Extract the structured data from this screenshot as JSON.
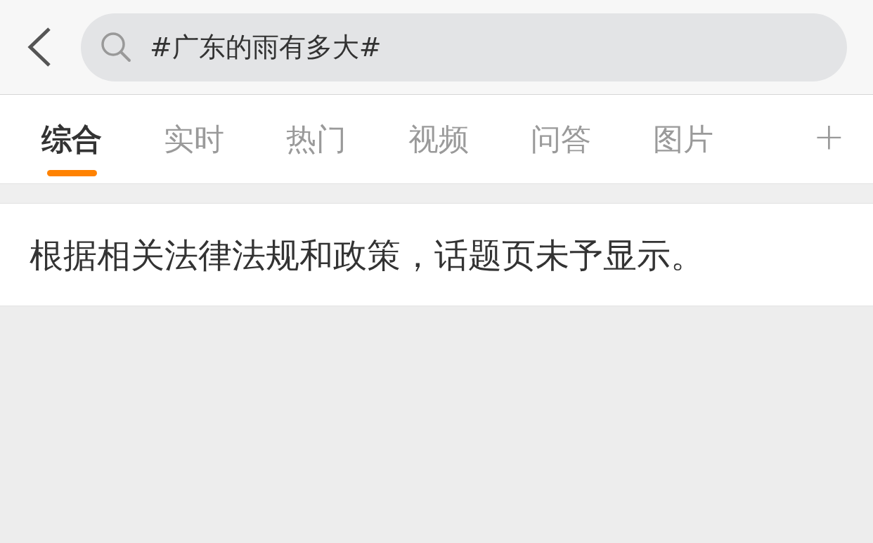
{
  "search": {
    "value": "#广东的雨有多大#"
  },
  "tabs": [
    {
      "label": "综合",
      "selected": true
    },
    {
      "label": "实时",
      "selected": false
    },
    {
      "label": "热门",
      "selected": false
    },
    {
      "label": "视频",
      "selected": false
    },
    {
      "label": "问答",
      "selected": false
    },
    {
      "label": "图片",
      "selected": false
    }
  ],
  "add_tab": "+",
  "notice": "根据相关法律法规和政策，话题页未予显示。"
}
